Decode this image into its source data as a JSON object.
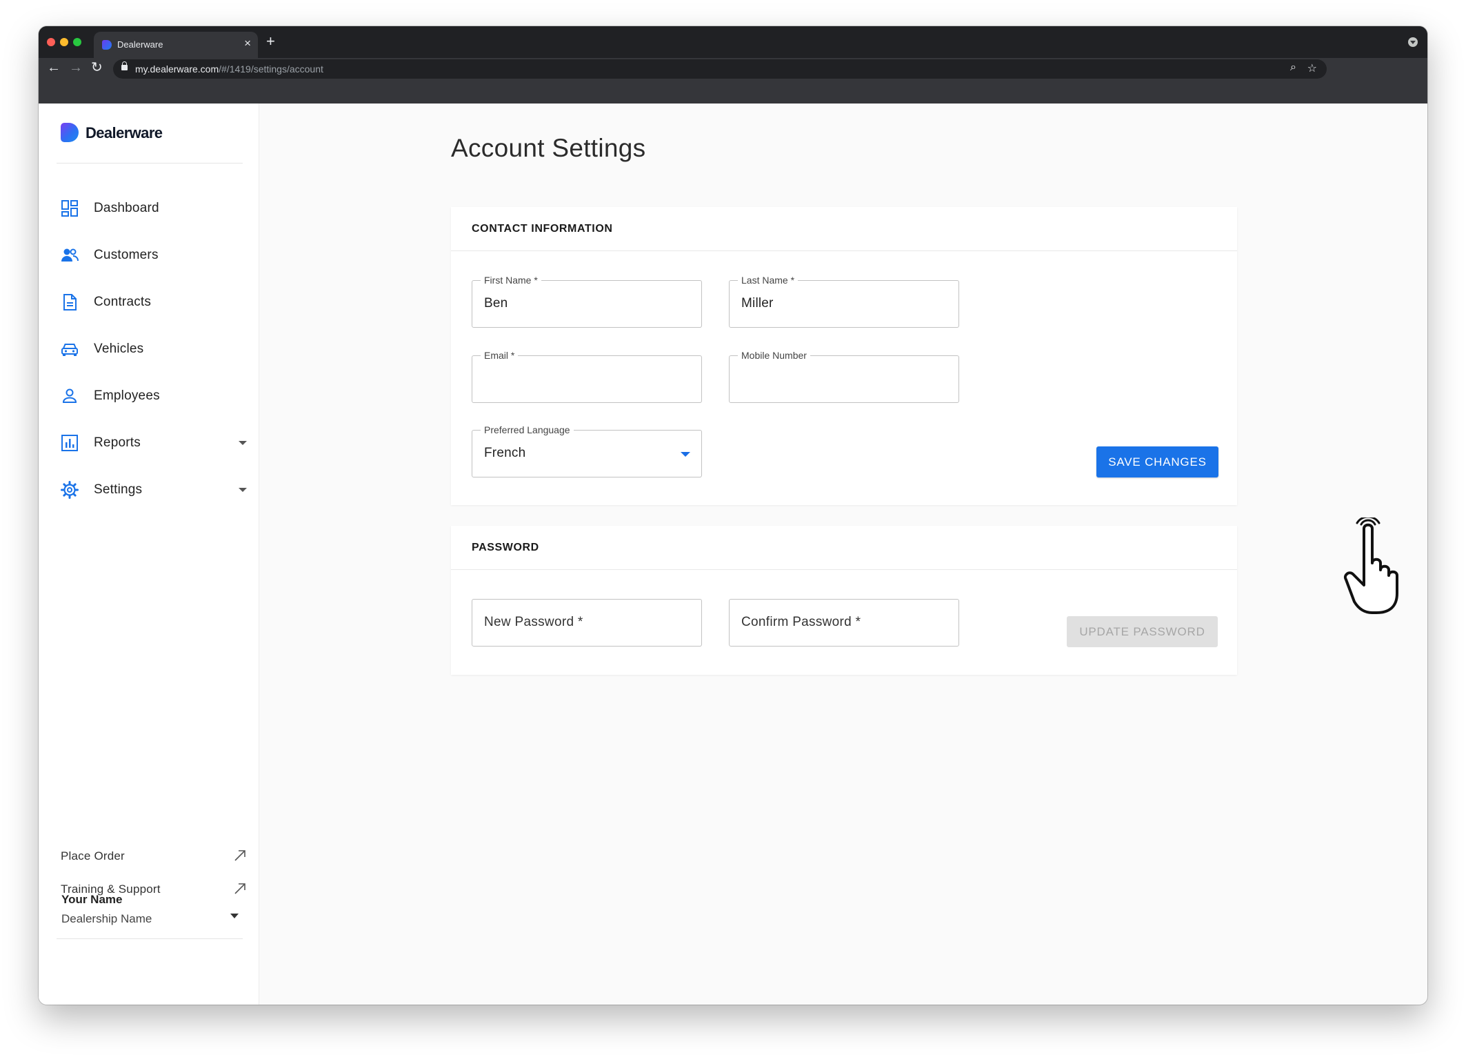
{
  "browser": {
    "tab_title": "Dealerware",
    "tab_close": "×",
    "new_tab": "+",
    "url_host": "my.dealerware.com",
    "url_path": "/#/1419/settings/account",
    "back": "←",
    "forward": "→",
    "reload": "↻",
    "zoom_icon": "⌕",
    "bookmark_icon": "☆"
  },
  "brand": {
    "name": "Dealerware",
    "accent": "#1a73e8"
  },
  "sidebar": {
    "items": [
      {
        "label": "Dashboard",
        "icon": "dashboard-icon"
      },
      {
        "label": "Customers",
        "icon": "customers-icon"
      },
      {
        "label": "Contracts",
        "icon": "contract-icon"
      },
      {
        "label": "Vehicles",
        "icon": "car-icon"
      },
      {
        "label": "Employees",
        "icon": "person-icon"
      },
      {
        "label": "Reports",
        "icon": "bar-chart-icon",
        "expandable": true
      },
      {
        "label": "Settings",
        "icon": "gear-icon",
        "expandable": true
      }
    ],
    "links": [
      {
        "label": "Place Order",
        "icon": "external-arrow-icon"
      },
      {
        "label": "Training & Support",
        "icon": "external-arrow-icon"
      }
    ],
    "user": {
      "name": "Your Name",
      "dealership": "Dealership Name"
    }
  },
  "page": {
    "title": "Account Settings"
  },
  "contact": {
    "header": "CONTACT INFORMATION",
    "first_name_label": "First Name *",
    "first_name_value": "Ben",
    "last_name_label": "Last Name *",
    "last_name_value": "Miller",
    "email_label": "Email *",
    "email_value": "",
    "mobile_label": "Mobile Number",
    "mobile_value": "",
    "language_label": "Preferred Language",
    "language_value": "French",
    "save_label": "SAVE CHANGES"
  },
  "password": {
    "header": "PASSWORD",
    "new_placeholder": "New Password *",
    "confirm_placeholder": "Confirm Password *",
    "update_label": "UPDATE PASSWORD"
  },
  "help": {
    "icon": "help-icon"
  }
}
